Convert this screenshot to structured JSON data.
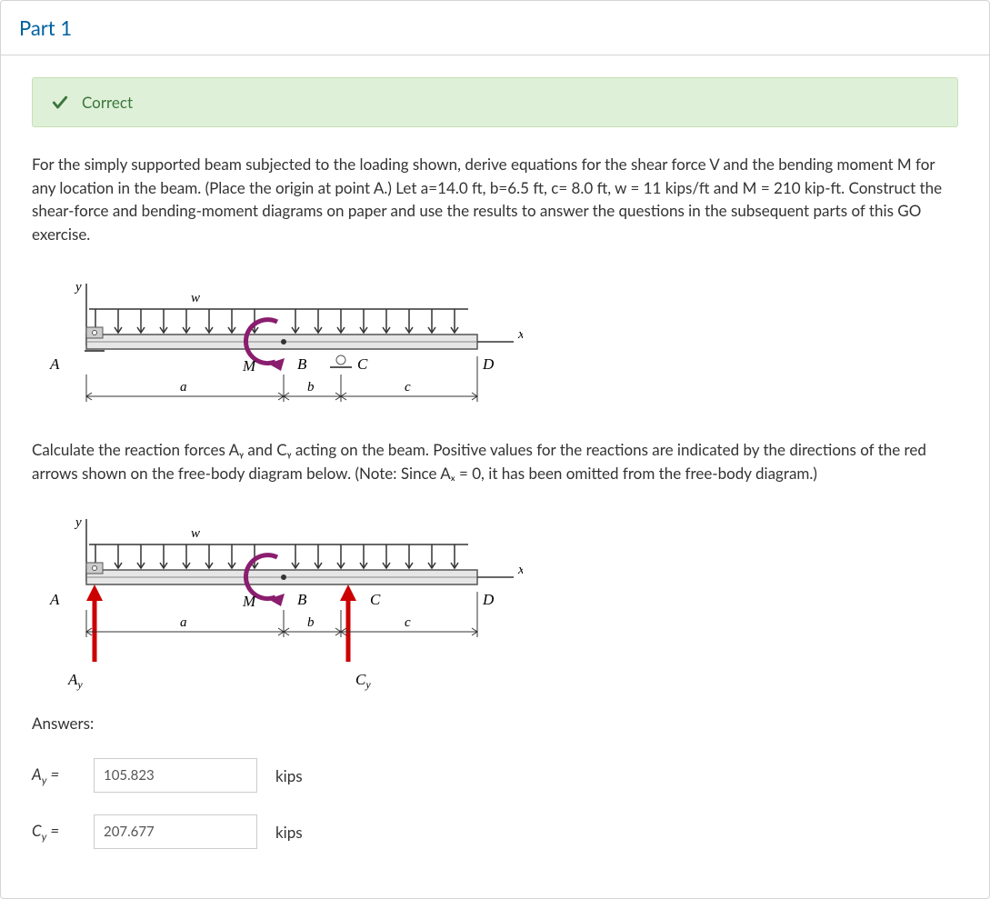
{
  "part_title": "Part 1",
  "status": {
    "text": "Correct"
  },
  "problem_statement": "For the simply supported beam subjected to the loading shown, derive equations for the shear force V and the bending moment M for any location in the beam. (Place the origin at point A.) Let a=14.0 ft, b=6.5 ft, c= 8.0 ft, w = 11 kips/ft and M = 210 kip-ft. Construct the shear-force and bending-moment diagrams on paper and use the results to answer the questions in the subsequent parts of this GO exercise.",
  "instruction": "Calculate the reaction forces Aᵧ and Cᵧ acting on the beam. Positive values for the reactions are indicated by the directions of the red arrows shown on the free-body diagram below. (Note: Since Aₓ = 0, it has been omitted from the free-body diagram.)",
  "diagram_labels": {
    "y": "y",
    "w": "w",
    "x": "x",
    "A": "A",
    "M": "M",
    "B": "B",
    "C": "C",
    "D": "D",
    "a": "a",
    "b": "b",
    "c": "c",
    "Ay": "Aᵧ",
    "Cy": "Cᵧ"
  },
  "answers_label": "Answers:",
  "answers": {
    "Ay": {
      "label_var": "A",
      "label_sub": "y",
      "equals": " = ",
      "value": "105.823",
      "unit": "kips"
    },
    "Cy": {
      "label_var": "C",
      "label_sub": "y",
      "equals": " = ",
      "value": "207.677",
      "unit": "kips"
    }
  }
}
